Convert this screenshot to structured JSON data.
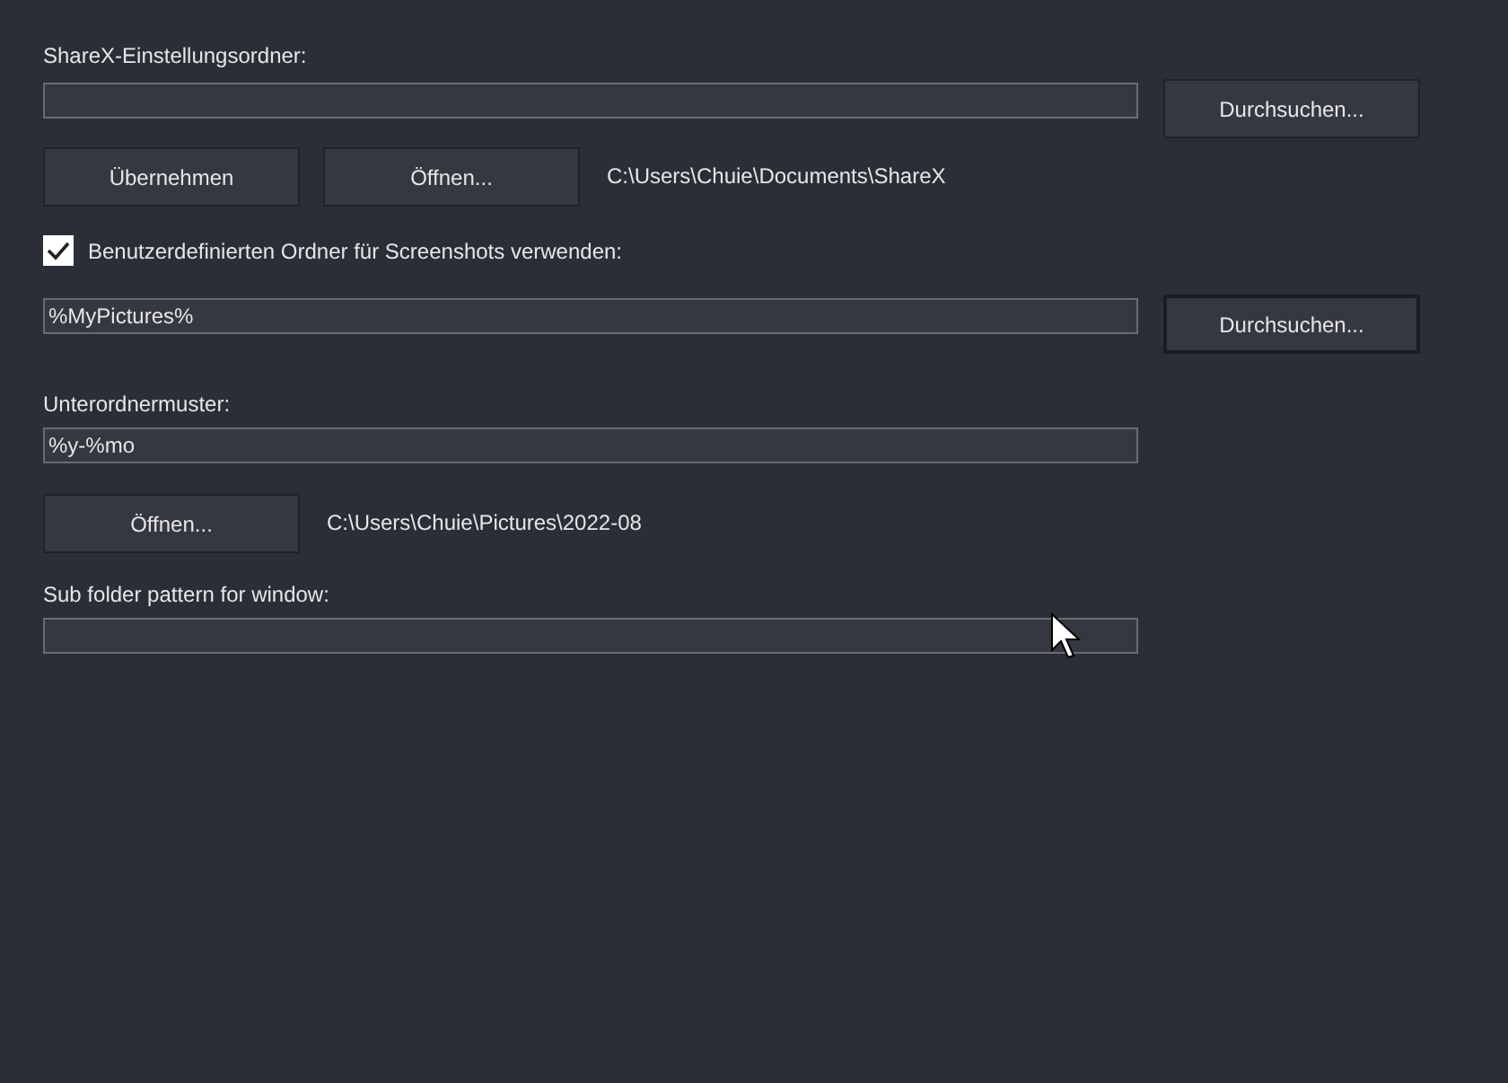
{
  "rows": [
    {
      "kind": "label",
      "text": "ShareX-Einstellungsordner:"
    },
    {
      "kind": "field",
      "button": {
        "label": "Durchsuchen...",
        "focused": false
      }
    },
    {
      "kind": "buttons",
      "buttons": [
        {
          "label": "Übernehmen",
          "focused": false
        },
        {
          "label": "Öffnen...",
          "focused": false
        }
      ],
      "path": "C:\\Users\\Chuie\\Documents\\ShareX"
    },
    {
      "kind": "checkbox",
      "label": "Benutzerdefinierten Ordner für Screenshots verwenden:",
      "checked": true
    },
    {
      "kind": "field",
      "value": "%MyPictures%",
      "button": {
        "label": "Durchsuchen...",
        "focused": true
      }
    },
    {
      "kind": "label",
      "text": "Unterordnermuster:"
    },
    {
      "kind": "field",
      "value": "%y-%mo"
    },
    {
      "kind": "buttons",
      "buttons": [
        {
          "label": "Öffnen...",
          "focused": false
        }
      ],
      "path": "C:\\Users\\Chuie\\Pictures\\2022-08"
    },
    {
      "kind": "label",
      "text": "Sub folder pattern for window:"
    },
    {
      "kind": "field"
    }
  ]
}
